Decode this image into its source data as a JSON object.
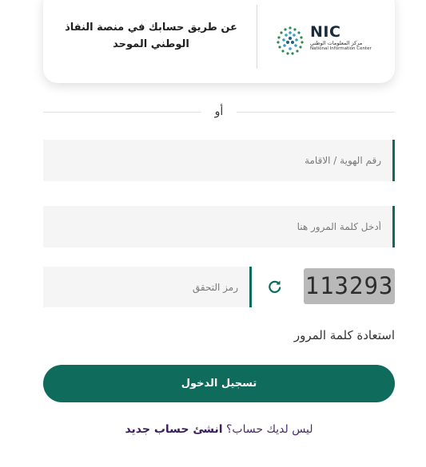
{
  "nafath_card": {
    "logo": {
      "mark_text": "NIC",
      "arabic_name": "مركز المعلومات الوطني",
      "english_name": "National Information Center"
    },
    "text": "عن طريق حسابك في منصة النفاذ الوطني الموحد"
  },
  "divider": {
    "text": "أو"
  },
  "form": {
    "id_placeholder": "رقم الهوية / الاقامة",
    "password_placeholder": "أدخل كلمة المرور هنا",
    "captcha_placeholder": "رمز التحقق",
    "captcha_code": "113293",
    "forgot_password": "استعادة كلمة المرور",
    "login_button": "تسجيل الدخول"
  },
  "signup": {
    "question": "ليس لديك حساب؟",
    "link": "انشئ حساب جديد"
  },
  "colors": {
    "primary": "#0f6b5c",
    "link_purple": "#3a1f5c",
    "field_bg": "#f5f5f5"
  },
  "icons": {
    "refresh": "refresh-icon"
  }
}
